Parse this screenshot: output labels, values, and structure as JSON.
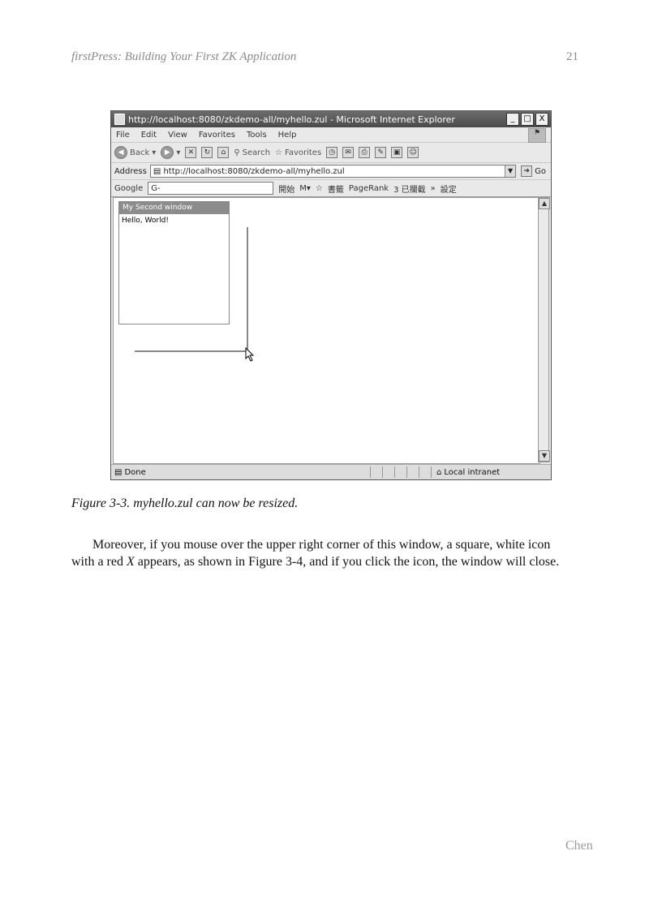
{
  "header": {
    "title": "firstPress: Building Your First ZK Application",
    "page_number": "21"
  },
  "browser": {
    "title": "http://localhost:8080/zkdemo-all/myhello.zul - Microsoft Internet Explorer",
    "window_buttons": {
      "minimize": "_",
      "maximize": "□",
      "close": "X"
    },
    "menu": [
      "File",
      "Edit",
      "View",
      "Favorites",
      "Tools",
      "Help"
    ],
    "toolbar": {
      "back": "Back",
      "search": "Search",
      "favorites": "Favorites"
    },
    "address_label": "Address",
    "address_url": "http://localhost:8080/zkdemo-all/myhello.zul",
    "go_label": "Go",
    "google_label": "Google",
    "google_field": "G-",
    "google_items": [
      "開始",
      "書籤",
      "PageRank",
      "3 已攔截",
      "設定"
    ],
    "status_text": "Done",
    "zone_text": "Local intranet"
  },
  "zk_window": {
    "title": "My Second window",
    "content": "Hello, World!"
  },
  "caption": "Figure 3-3. myhello.zul can now be resized.",
  "paragraph": {
    "part1": "Moreover, if you mouse over the upper right corner of this window, a square, white icon with a red ",
    "em": "X",
    "part2": " appears, as shown in Figure 3-4, and if you click the icon, the window will close."
  },
  "footer": "Chen"
}
